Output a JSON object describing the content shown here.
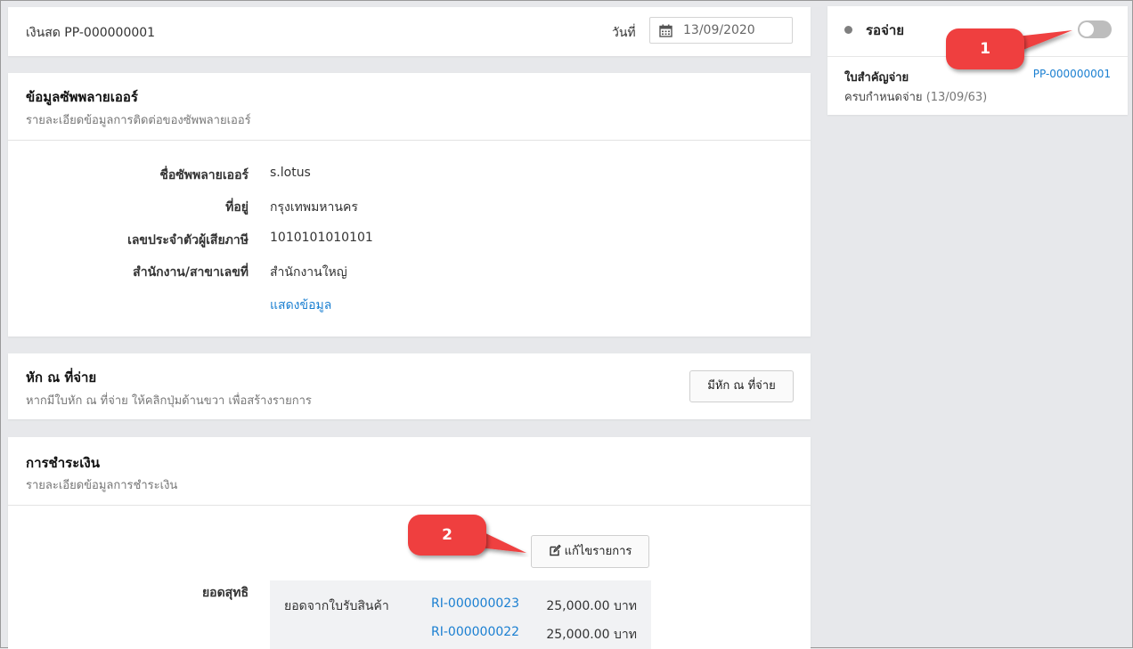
{
  "header": {
    "doc_title": "เงินสด PP-000000001",
    "date_label": "วันที่",
    "date_value": "13/09/2020"
  },
  "supplier": {
    "title": "ข้อมูลซัพพลายเออร์",
    "subtitle": "รายละเอียดข้อมูลการติดต่อของซัพพลายเออร์",
    "fields": [
      {
        "label": "ชื่อซัพพลายเออร์",
        "value": "s.lotus"
      },
      {
        "label": "ที่อยู่",
        "value": "กรุงเทพมหานคร"
      },
      {
        "label": "เลขประจำตัวผู้เสียภาษี",
        "value": "1010101010101"
      },
      {
        "label": "สำนักงาน/สาขาเลขที่",
        "value": "สำนักงานใหญ่"
      }
    ],
    "show_more_link": "แสดงข้อมูล"
  },
  "withholding": {
    "title": "หัก ณ ที่จ่าย",
    "subtitle": "หากมีใบหัก ณ ที่จ่าย ให้คลิกปุ่มด้านขวา เพื่อสร้างรายการ",
    "button_label": "มีหัก ณ ที่จ่าย"
  },
  "payment": {
    "title": "การชำระเงิน",
    "subtitle": "รายละเอียดข้อมูลการชำระเงิน",
    "edit_button_label": "แก้ไขรายการ",
    "net_label": "ยอดสุทธิ",
    "rows": [
      {
        "desc": "ยอดจากใบรับสินค้า",
        "ref": "RI-000000023",
        "amount": "25,000.00 บาท"
      },
      {
        "desc": "",
        "ref": "RI-000000022",
        "amount": "25,000.00 บาท"
      }
    ]
  },
  "status_panel": {
    "status_label": "รอจ่าย",
    "toggle_on": false,
    "doc_kind": "ใบสำคัญจ่าย",
    "doc_no": "PP-000000001",
    "due_label": "ครบกำหนดจ่าย",
    "due_date": "(13/09/63)"
  },
  "annotations": {
    "callout_1": "1",
    "callout_2": "2",
    "color": "#ef3f3f"
  },
  "colors": {
    "accent_link": "#1a7fd1",
    "page_bg": "#e7e8eb"
  }
}
